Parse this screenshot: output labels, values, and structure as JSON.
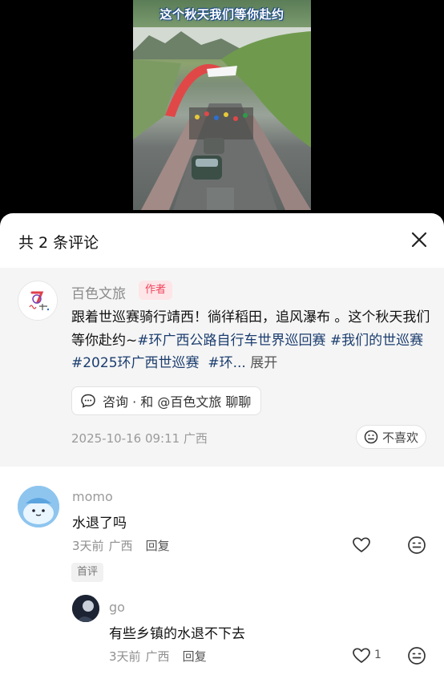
{
  "video": {
    "caption": "这个秋天我们等你赴约"
  },
  "sheet": {
    "title": "共 2 条评论"
  },
  "pinned": {
    "author": "百色文旅",
    "badge": "作者",
    "text_plain": "跟着世巡赛骑行靖西！徜徉稻田，追风瀑布 。这个秋天我们等你赴约~",
    "tags": [
      "#环广西公路自行车世界巡回赛",
      "#我们的世巡赛",
      "#2025环广西世巡赛",
      "#环..."
    ],
    "more": "展开",
    "consult": "咨询 · 和 @百色文旅 聊聊",
    "meta": "2025-10-16 09:11 广西",
    "dislike": "不喜欢"
  },
  "comments": [
    {
      "name": "momo",
      "text": "水退了吗",
      "time": "3天前",
      "region": "广西",
      "reply": "回复",
      "badge": "首评"
    },
    {
      "name": "go",
      "text": "有些乡镇的水退不下去",
      "time": "3天前",
      "region": "广西",
      "reply": "回复",
      "likes": "1"
    }
  ],
  "icons": {
    "close": "close-icon",
    "chat": "chat-bubble-icon",
    "dislike": "sad-face-icon",
    "like": "heart-icon",
    "react": "smile-face-icon"
  }
}
